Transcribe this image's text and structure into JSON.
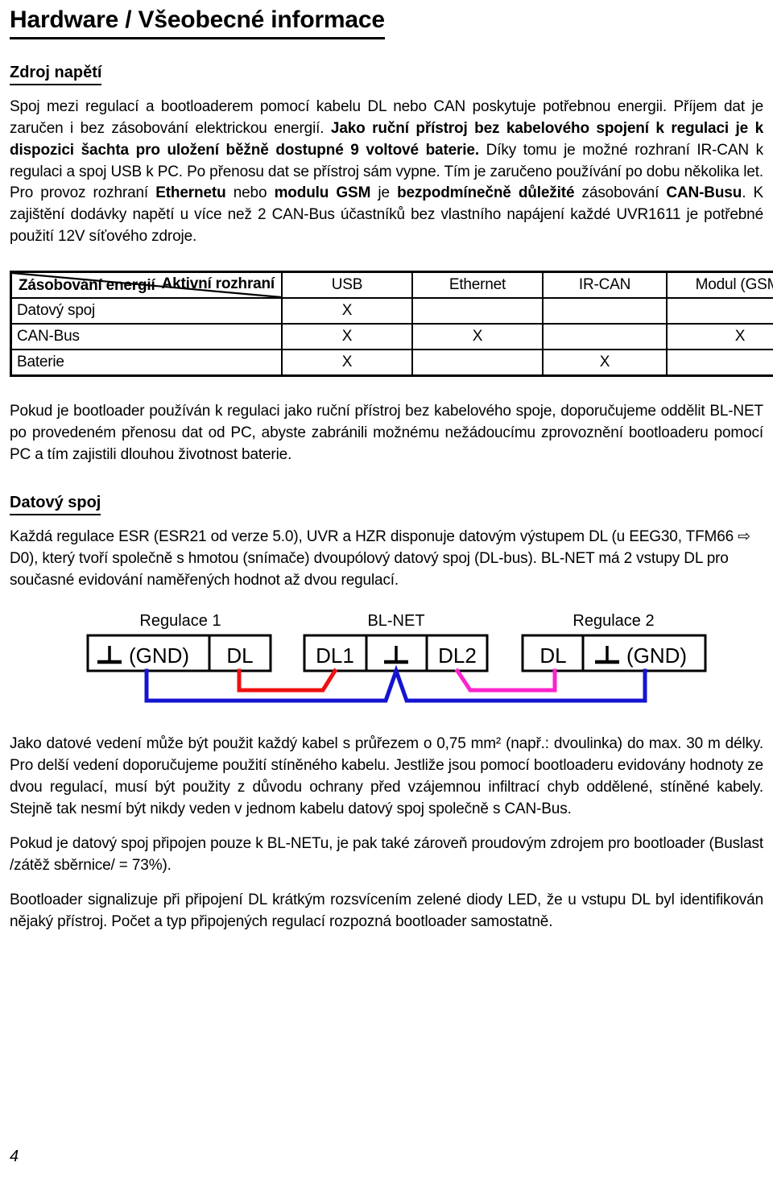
{
  "document": {
    "title": "Hardware / Všeobecné informace",
    "page_number": "4"
  },
  "sections": [
    {
      "heading": "Zdroj napětí"
    },
    {
      "heading": "Datový spoj"
    }
  ],
  "paragraphs": {
    "p1_part1": "Spoj mezi regulací a bootloaderem pomocí kabelu DL nebo CAN poskytuje potřebnou energii. Příjem dat je zaručen i bez zásobování elektrickou energií. ",
    "p1_bold1": "Jako ruční přístroj bez kabelového spojení k regulaci je k dispozici šachta pro uložení běžně dostupné 9 voltové baterie.",
    "p1_part2": " Díky tomu je možné rozhraní IR-CAN k regulaci a spoj USB k PC. Po přenosu dat se přístroj sám vypne. Tím je zaručeno používání po dobu několika let. Pro provoz rozhraní ",
    "p1_bold2": "Ethernetu",
    "p1_part3": " nebo ",
    "p1_bold3": "modulu GSM",
    "p1_part4": " je ",
    "p1_bold4": "bezpodmínečně důležité",
    "p1_part5": " zásobování ",
    "p1_bold5": "CAN-Busu",
    "p1_part6": ". K zajištění dodávky napětí u více než 2 CAN-Bus účastníků bez vlastního napájení každé UVR1611 je potřebné použití 12V síťového zdroje.",
    "p2": "Pokud je bootloader používán k regulaci jako ruční přístroj bez kabelového spoje, doporučujeme oddělit BL-NET po provedeném přenosu dat od PC, abyste zabránili možnému nežádoucímu zprovoznění bootloaderu pomocí PC a tím zajistili dlouhou životnost baterie.",
    "p3": "Každá regulace ESR (ESR21 od verze 5.0), UVR a HZR disponuje datovým výstupem DL (u EEG30, TFM66 ⇨ D0), který tvoří společně s hmotou (snímače) dvoupólový datový spoj (DL-bus). BL-NET má 2 vstupy DL pro současné evidování naměřených hodnot až dvou regulací.",
    "p4": "Jako datové vedení může být použit každý kabel s průřezem o 0,75 mm² (např.: dvoulinka) do max. 30 m délky. Pro delší vedení doporučujeme použití stíněného kabelu. Jestliže jsou pomocí bootloaderu evidovány hodnoty ze dvou regulací, musí být použity z důvodu ochrany před vzájemnou infiltrací chyb oddělené, stíněné kabely. Stejně tak nesmí být nikdy veden v jednom kabelu datový spoj společně s  CAN-Bus.",
    "p5": "Pokud je datový spoj připojen pouze k BL-NETu, je pak také zároveň proudovým zdrojem pro bootloader (Buslast /zátěž sběrnice/ = 73%).",
    "p6": "Bootloader signalizuje při připojení DL krátkým rozsvícením zelené diody LED, že u vstupu DL byl identifikován nějaký přístroj. Počet a typ připojených regulací rozpozná bootloader samostatně."
  },
  "iface_table": {
    "corner_top_right": "Aktivní rozhraní",
    "corner_bottom_left": "Zásobování energií",
    "columns": [
      "USB",
      "Ethernet",
      "IR-CAN",
      "Modul (GSM)"
    ],
    "rows": [
      {
        "label": "Datový spoj",
        "cells": [
          "X",
          "",
          "",
          ""
        ]
      },
      {
        "label": "CAN-Bus",
        "cells": [
          "X",
          "X",
          "",
          "X"
        ]
      },
      {
        "label": "Baterie",
        "cells": [
          "X",
          "",
          "X",
          ""
        ]
      }
    ]
  },
  "wiring_diagram": {
    "labels": {
      "left_device": "Regulace 1",
      "center_device": "BL-NET",
      "right_device": "Regulace 2"
    },
    "terminals": {
      "left_gnd": "(GND)",
      "left_dl": "DL",
      "center_dl1": "DL1",
      "center_dl2": "DL2",
      "right_dl": "DL",
      "right_gnd": "(GND)"
    },
    "wire_colors": {
      "ground": "#1414d2",
      "dl1_link": "#ee1111",
      "dl2_link": "#ff22cc"
    }
  }
}
